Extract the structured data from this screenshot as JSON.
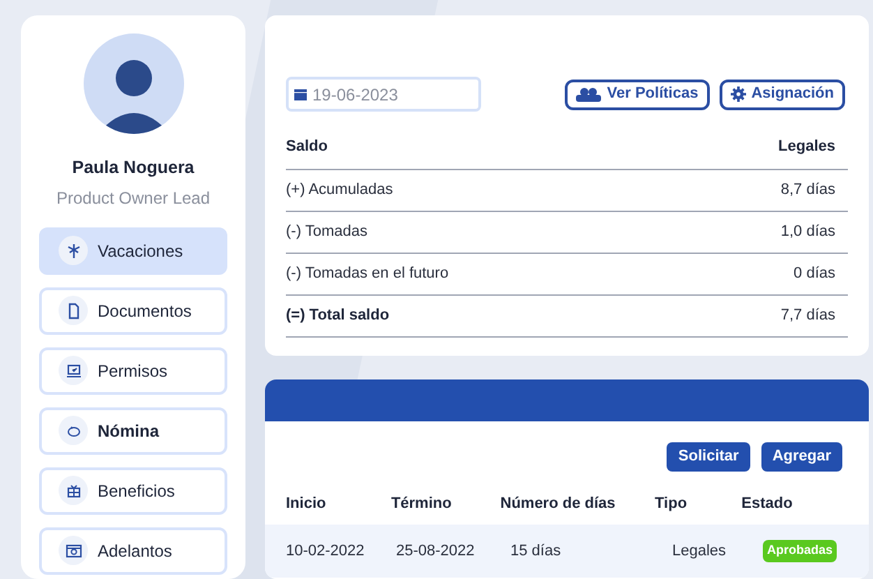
{
  "profile": {
    "name": "Paula Noguera",
    "role": "Product Owner Lead"
  },
  "nav": [
    {
      "label": "Vacaciones",
      "selected": true,
      "bold": false
    },
    {
      "label": "Documentos",
      "selected": false,
      "bold": false
    },
    {
      "label": "Permisos",
      "selected": false,
      "bold": false
    },
    {
      "label": "Nómina",
      "selected": false,
      "bold": true
    },
    {
      "label": "Beneficios",
      "selected": false,
      "bold": false
    },
    {
      "label": "Adelantos",
      "selected": false,
      "bold": false
    }
  ],
  "date_field": {
    "placeholder": "19-06-2023"
  },
  "top_buttons": [
    {
      "label": "Ver Políticas"
    },
    {
      "label": "Asignación"
    }
  ],
  "balance": {
    "columns": [
      "Saldo",
      "Legales"
    ],
    "rows": [
      {
        "label": "(+) Acumuladas",
        "value": "8,7 días",
        "total": false
      },
      {
        "label": "(-) Tomadas",
        "value": "1,0 días",
        "total": false
      },
      {
        "label": "(-) Tomadas en el futuro",
        "value": "0 días",
        "total": false
      },
      {
        "label": "(=) Total saldo",
        "value": "7,7 días",
        "total": true
      }
    ]
  },
  "requests": {
    "buttons": [
      "Solicitar",
      "Agregar"
    ],
    "columns": [
      "Inicio",
      "Término",
      "Número de días",
      "Tipo",
      "Estado"
    ],
    "rows": [
      {
        "inicio": "10-02-2022",
        "termino": "25-08-2022",
        "dias": "15 días",
        "tipo": "Legales",
        "estado": "Aprobadas",
        "color": "#5ac91f"
      }
    ]
  }
}
